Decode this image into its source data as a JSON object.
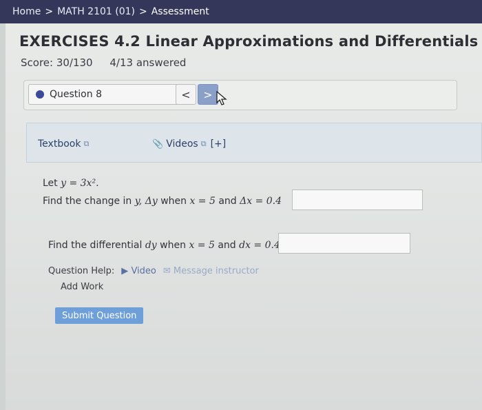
{
  "breadcrumb": {
    "home": "Home",
    "sep": ">",
    "course": "MATH 2101 (01)",
    "current": "Assessment"
  },
  "header": {
    "title": "EXERCISES 4.2 Linear Approximations and Differentials",
    "score": "Score: 30/130",
    "answered": "4/13 answered"
  },
  "question_nav": {
    "selected": "Question 8",
    "prev_label": "<",
    "next_label": ">"
  },
  "resources": {
    "textbook": "Textbook",
    "videos": "Videos",
    "expand": "[+]"
  },
  "problem": {
    "let_prefix": "Let",
    "let_equation": "y = 3x².",
    "part1_prefix": "Find the change in",
    "part1_var": "y,",
    "part1_delta": "Δy",
    "part1_when": "when",
    "part1_cond": "x = 5",
    "part1_and": "and",
    "part1_dx": "Δx = 0.4",
    "part2_prefix": "Find the differential",
    "part2_var": "dy",
    "part2_when": "when",
    "part2_cond": "x = 5",
    "part2_and": "and",
    "part2_dx": "dx = 0.4",
    "answer1_value": "",
    "answer2_value": ""
  },
  "help": {
    "label": "Question Help:",
    "video": "Video",
    "message": "Message instructor",
    "add_work": "Add Work"
  },
  "submit_label": "Submit Question",
  "colors": {
    "topbar": "#34375a",
    "submit": "#6e9fd9",
    "selected_dot": "#3b4a9a",
    "next_button": "#8aa0c9"
  }
}
